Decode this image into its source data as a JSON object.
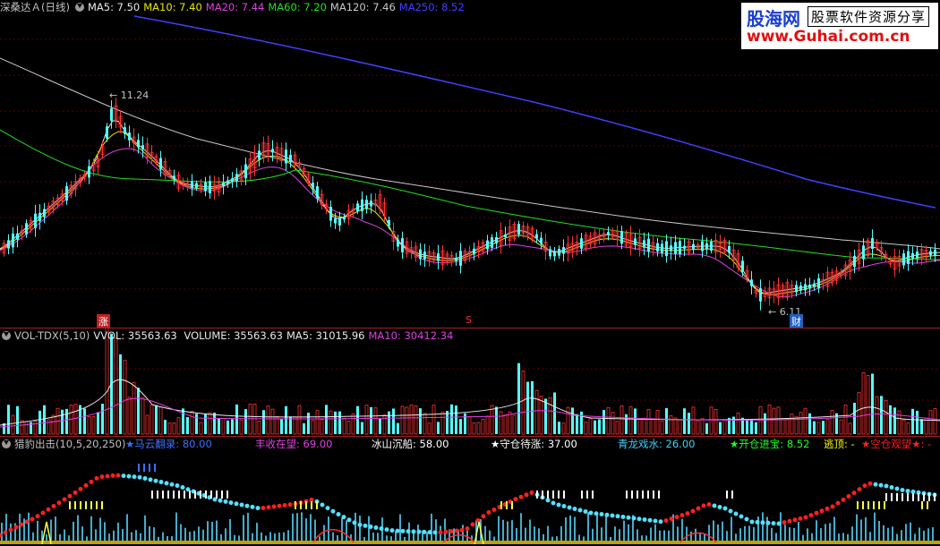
{
  "price": {
    "title": "深桑达Ａ(日线)",
    "ma5": "MA5: 7.50",
    "ma10": "MA10: 7.40",
    "ma20": "MA20: 7.44",
    "ma60": "MA60: 7.20",
    "ma120": "MA120: 7.46",
    "ma250": "MA250: 8.52",
    "high_label": "11.24",
    "low_label": "6.11",
    "mark_zhang": "涨",
    "mark_s": "S",
    "mark_cai": "财",
    "colors": {
      "ma5": "#e8e8e8",
      "ma10": "#e8e800",
      "ma20": "#e040e0",
      "ma60": "#20e020",
      "ma120": "#c8c8c8",
      "ma250": "#4040ff"
    }
  },
  "volume": {
    "title": "VOL-TDX(5,10)",
    "vvol": "VVOL: 35563.63",
    "volume": "VOLUME: 35563.63",
    "ma5": "MA5: 31015.96",
    "ma10": "MA10: 30412.34"
  },
  "indicator": {
    "title": "猎豹出击(10,5,20,250)",
    "items": [
      {
        "label": "★马云翻录: 80.00",
        "color": "#4070ff"
      },
      {
        "label": "丰收在望: 69.00",
        "color": "#e040e0"
      },
      {
        "label": "冰山沉船: 58.00",
        "color": "#ffffff"
      },
      {
        "label": "★守仓待涨: 37.00",
        "color": "#ffffff",
        "star": "#ffff00"
      },
      {
        "label": "青龙戏水: 26.00",
        "color": "#40d0ff"
      },
      {
        "label": "★开仓进宝: 8.52",
        "color": "#20ff20"
      },
      {
        "label": "逃顶: -",
        "color": "#ffff00"
      },
      {
        "label": "★空仓观望★: -",
        "color": "#ff2020"
      }
    ]
  },
  "watermark": {
    "line1a": "股海网",
    "line1b": "股票软件资源分享",
    "line2": "www.Guhai.com.cn"
  }
}
